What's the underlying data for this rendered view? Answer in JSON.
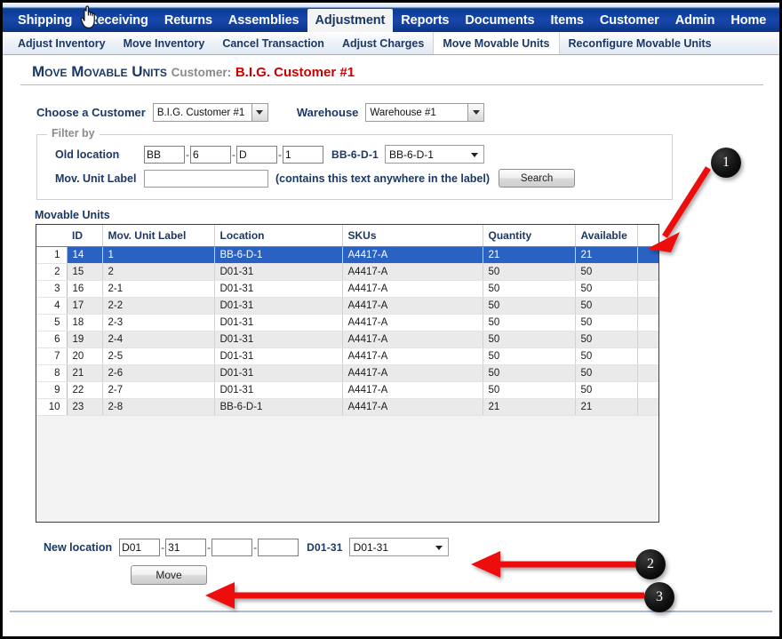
{
  "topnav": {
    "items": [
      {
        "label": "Shipping",
        "active": false
      },
      {
        "label": "Receiving",
        "active": false
      },
      {
        "label": "Returns",
        "active": false
      },
      {
        "label": "Assemblies",
        "active": false
      },
      {
        "label": "Adjustment",
        "active": true
      },
      {
        "label": "Reports",
        "active": false
      },
      {
        "label": "Documents",
        "active": false
      },
      {
        "label": "Items",
        "active": false
      },
      {
        "label": "Customer",
        "active": false
      },
      {
        "label": "Admin",
        "active": false
      },
      {
        "label": "Home",
        "active": false
      }
    ]
  },
  "subnav": {
    "items": [
      {
        "label": "Adjust Inventory",
        "active": false
      },
      {
        "label": "Move Inventory",
        "active": false
      },
      {
        "label": "Cancel Transaction",
        "active": false
      },
      {
        "label": "Adjust Charges",
        "active": false
      },
      {
        "label": "Move Movable Units",
        "active": true
      },
      {
        "label": "Reconfigure Movable Units",
        "active": false
      }
    ]
  },
  "page": {
    "title": "Move Movable Units",
    "customer_label": "Customer:",
    "customer_name": "B.I.G. Customer #1"
  },
  "selectors": {
    "customer_label": "Choose a Customer",
    "customer_value": "B.I.G. Customer #1",
    "warehouse_label": "Warehouse",
    "warehouse_value": "Warehouse #1"
  },
  "filter": {
    "legend": "Filter by",
    "old_location_label": "Old location",
    "old_location_parts": [
      "BB",
      "6",
      "D",
      "1"
    ],
    "old_location_code": "BB-6-D-1",
    "old_location_select_value": "BB-6-D-1",
    "mov_unit_label": "Mov. Unit Label",
    "mov_unit_value": "",
    "mov_unit_placeholder": "",
    "hint": "(contains this text anywhere in the label)",
    "search_button": "Search"
  },
  "grid": {
    "caption": "Movable Units",
    "columns": [
      "",
      "ID",
      "Mov. Unit Label",
      "Location",
      "SKUs",
      "Quantity",
      "Available",
      ""
    ],
    "rows": [
      {
        "n": "1",
        "id": "14",
        "label": "1",
        "location": "BB-6-D-1",
        "sku": "A4417-A",
        "quantity": "21",
        "available": "21",
        "selected": true
      },
      {
        "n": "2",
        "id": "15",
        "label": "2",
        "location": "D01-31",
        "sku": "A4417-A",
        "quantity": "50",
        "available": "50",
        "selected": false
      },
      {
        "n": "3",
        "id": "16",
        "label": "2-1",
        "location": "D01-31",
        "sku": "A4417-A",
        "quantity": "50",
        "available": "50",
        "selected": false
      },
      {
        "n": "4",
        "id": "17",
        "label": "2-2",
        "location": "D01-31",
        "sku": "A4417-A",
        "quantity": "50",
        "available": "50",
        "selected": false
      },
      {
        "n": "5",
        "id": "18",
        "label": "2-3",
        "location": "D01-31",
        "sku": "A4417-A",
        "quantity": "50",
        "available": "50",
        "selected": false
      },
      {
        "n": "6",
        "id": "19",
        "label": "2-4",
        "location": "D01-31",
        "sku": "A4417-A",
        "quantity": "50",
        "available": "50",
        "selected": false
      },
      {
        "n": "7",
        "id": "20",
        "label": "2-5",
        "location": "D01-31",
        "sku": "A4417-A",
        "quantity": "50",
        "available": "50",
        "selected": false
      },
      {
        "n": "8",
        "id": "21",
        "label": "2-6",
        "location": "D01-31",
        "sku": "A4417-A",
        "quantity": "50",
        "available": "50",
        "selected": false
      },
      {
        "n": "9",
        "id": "22",
        "label": "2-7",
        "location": "D01-31",
        "sku": "A4417-A",
        "quantity": "50",
        "available": "50",
        "selected": false
      },
      {
        "n": "10",
        "id": "23",
        "label": "2-8",
        "location": "BB-6-D-1",
        "sku": "A4417-A",
        "quantity": "21",
        "available": "21",
        "selected": false
      }
    ]
  },
  "newlocation": {
    "label": "New location",
    "parts": [
      "D01",
      "31",
      "",
      ""
    ],
    "code": "D01-31",
    "select_value": "D01-31",
    "move_button": "Move"
  },
  "annotations": [
    {
      "number": "1"
    },
    {
      "number": "2"
    },
    {
      "number": "3"
    }
  ],
  "colors": {
    "nav_blue": "#0d3f9c",
    "accent_dark_blue": "#1b3864",
    "customer_red": "#cc0000",
    "row_selected": "#2a62c4",
    "annotation_red": "#ee1111"
  }
}
